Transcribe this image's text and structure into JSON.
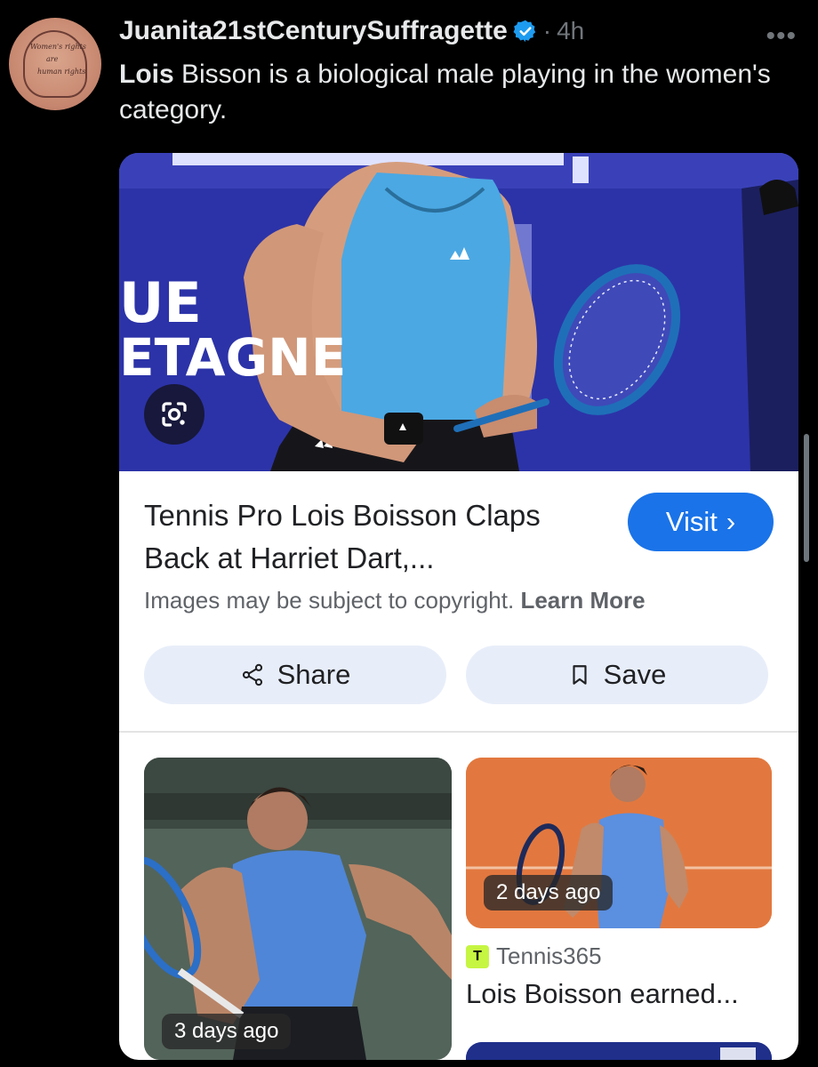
{
  "tweet": {
    "avatar_text": [
      "Women's rights",
      "are",
      "human rights"
    ],
    "username": "Juanita21stCenturySuffragette",
    "separator": "·",
    "time": "4h",
    "text_bold": "Lois",
    "text_rest": " Bisson is a biological male playing in the women's category."
  },
  "card": {
    "hero_banner_text": [
      "UE",
      "ETAGNE"
    ],
    "result_title": "Tennis Pro Lois Boisson Claps Back at Harriet Dart,...",
    "visit_label": "Visit",
    "visit_arrow": "›",
    "copyright_text": "Images may be subject to copyright.",
    "learn_more": "Learn More",
    "share_label": "Share",
    "save_label": "Save",
    "thumbnails": [
      {
        "badge": "3 days ago"
      },
      {
        "badge": "2 days ago",
        "source": "Tennis365",
        "snippet": "Lois Boisson earned..."
      }
    ]
  },
  "colors": {
    "background": "#000000",
    "verified": "#1d9bf0",
    "visit_button": "#1a73e8",
    "pill": "#e8eef9"
  }
}
